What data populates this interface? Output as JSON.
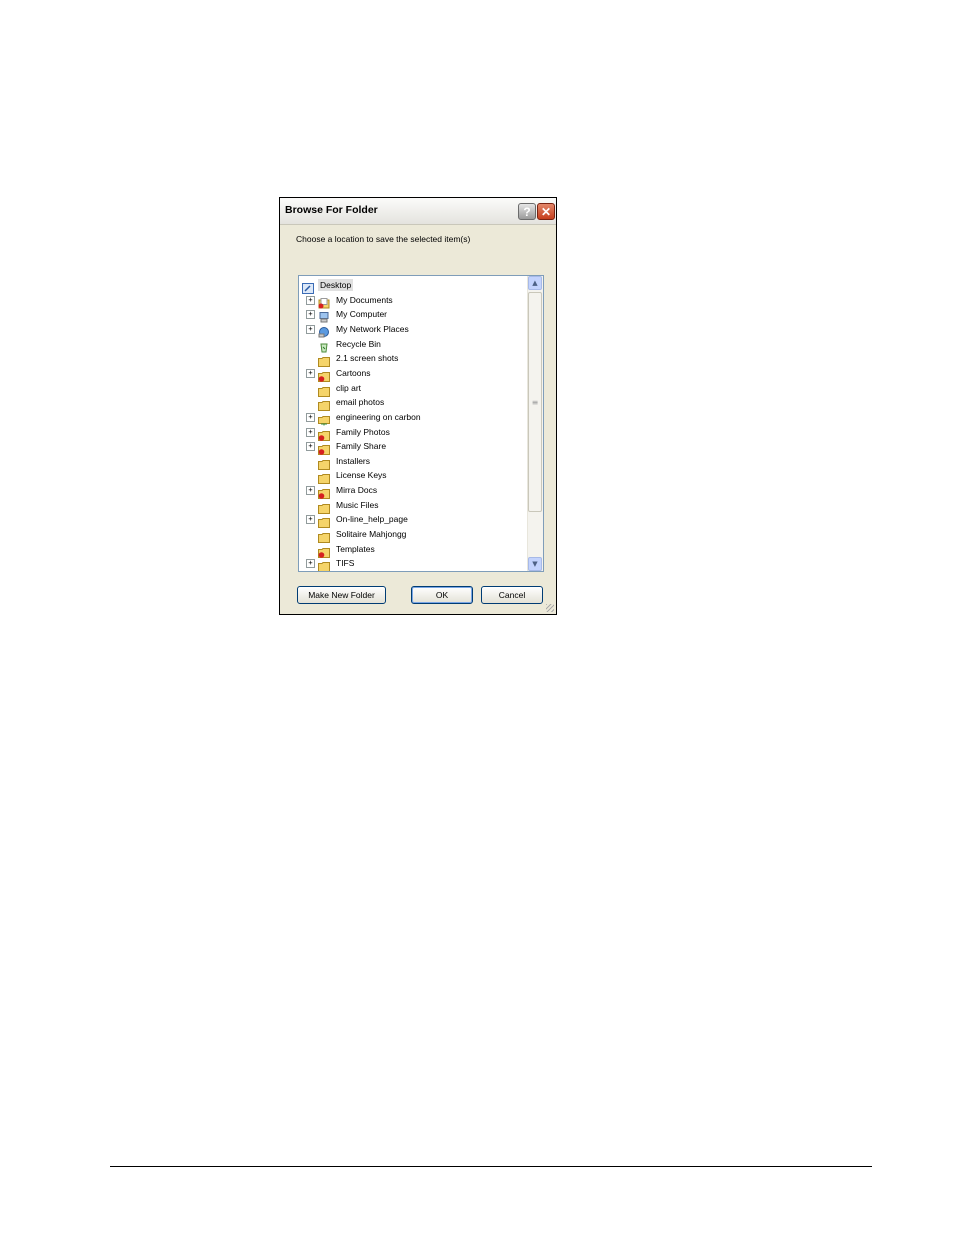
{
  "dialog": {
    "title": "Browse For Folder",
    "help_glyph": "?",
    "close_glyph": "✕",
    "prompt": "Choose a location to save the selected item(s)",
    "tree": [
      {
        "label": "Desktop",
        "icon": "desktop-icon",
        "expander": false,
        "selected": true
      },
      {
        "label": "My Documents",
        "icon": "my-documents-icon",
        "expander": true
      },
      {
        "label": "My Computer",
        "icon": "my-computer-icon",
        "expander": true
      },
      {
        "label": "My Network Places",
        "icon": "network-places-icon",
        "expander": true
      },
      {
        "label": "Recycle Bin",
        "icon": "recycle-bin-icon",
        "expander": false
      },
      {
        "label": "2.1 screen shots",
        "icon": "folder-icon",
        "expander": false
      },
      {
        "label": "Cartoons",
        "icon": "shared-folder-icon",
        "expander": true
      },
      {
        "label": "clip art",
        "icon": "folder-icon",
        "expander": false
      },
      {
        "label": "email photos",
        "icon": "folder-icon",
        "expander": false
      },
      {
        "label": "engineering on carbon",
        "icon": "network-folder-icon",
        "expander": true
      },
      {
        "label": "Family Photos",
        "icon": "shared-folder-icon",
        "expander": true
      },
      {
        "label": "Family Share",
        "icon": "shared-folder-icon",
        "expander": true
      },
      {
        "label": "Installers",
        "icon": "folder-icon",
        "expander": false
      },
      {
        "label": "License Keys",
        "icon": "folder-icon",
        "expander": false
      },
      {
        "label": "Mirra Docs",
        "icon": "shared-folder-icon",
        "expander": true
      },
      {
        "label": "Music Files",
        "icon": "folder-icon",
        "expander": false
      },
      {
        "label": "On-line_help_page",
        "icon": "folder-icon",
        "expander": true
      },
      {
        "label": "Solitaire Mahjongg",
        "icon": "folder-icon",
        "expander": false
      },
      {
        "label": "Templates",
        "icon": "shared-folder-icon",
        "expander": false
      },
      {
        "label": "TIFS",
        "icon": "folder-icon",
        "expander": true
      }
    ],
    "buttons": {
      "make_new_folder": "Make New Folder",
      "ok": "OK",
      "cancel": "Cancel"
    },
    "colors": {
      "folder": "#f5d46a",
      "shared_folder_accent": "#d62020",
      "selection": "#e0e0e0",
      "close_button": "#c63f1d"
    }
  }
}
